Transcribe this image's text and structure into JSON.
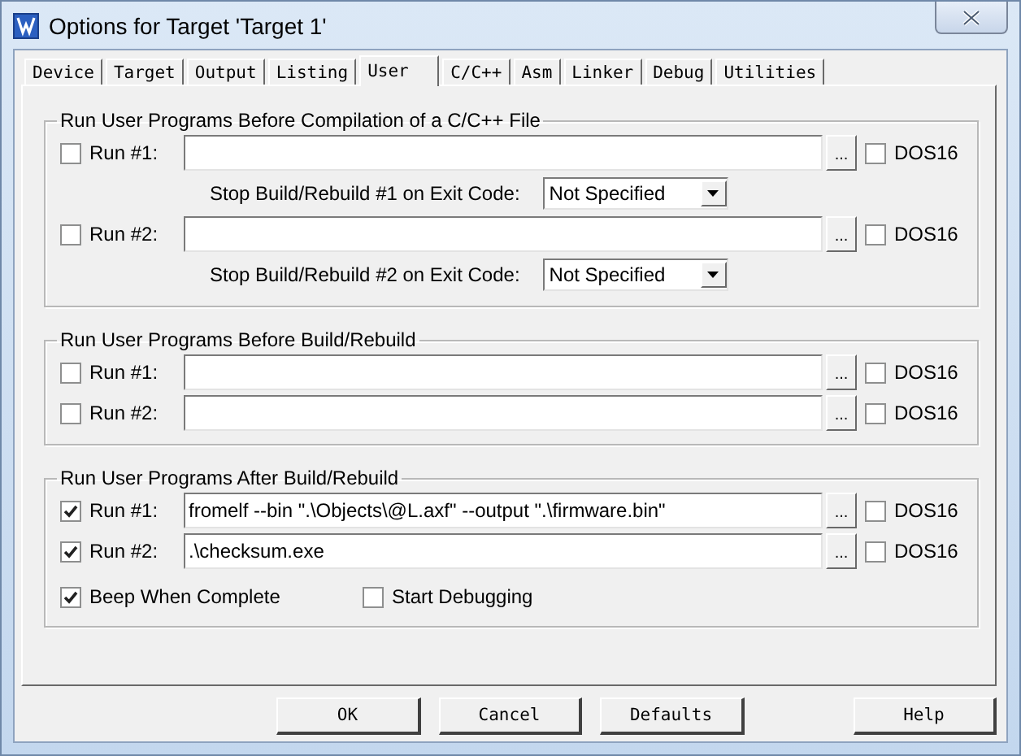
{
  "window": {
    "title": "Options for Target 'Target 1'"
  },
  "tabs": [
    {
      "label": "Device",
      "selected": false
    },
    {
      "label": "Target",
      "selected": false
    },
    {
      "label": "Output",
      "selected": false
    },
    {
      "label": "Listing",
      "selected": false
    },
    {
      "label": "User",
      "selected": true
    },
    {
      "label": "C/C++",
      "selected": false
    },
    {
      "label": "Asm",
      "selected": false
    },
    {
      "label": "Linker",
      "selected": false
    },
    {
      "label": "Debug",
      "selected": false
    },
    {
      "label": "Utilities",
      "selected": false
    }
  ],
  "groups": [
    {
      "title": "Run User Programs Before Compilation of a C/C++ File",
      "rows": [
        {
          "kind": "run",
          "label": "Run #1:",
          "checked": false,
          "browse": "...",
          "dos16": {
            "label": "DOS16",
            "checked": false
          }
        },
        {
          "kind": "exit-code",
          "label": "Stop Build/Rebuild #1 on Exit Code:",
          "selection": "Not Specified"
        },
        {
          "kind": "run",
          "label": "Run #2:",
          "checked": false,
          "browse": "...",
          "dos16": {
            "label": "DOS16",
            "checked": false
          }
        },
        {
          "kind": "exit-code",
          "label": "Stop Build/Rebuild #2 on Exit Code:",
          "selection": "Not Specified"
        }
      ]
    },
    {
      "title": "Run User Programs Before Build/Rebuild",
      "rows": [
        {
          "kind": "run",
          "label": "Run #1:",
          "checked": false,
          "browse": "...",
          "dos16": {
            "label": "DOS16",
            "checked": false
          }
        },
        {
          "kind": "run",
          "label": "Run #2:",
          "checked": false,
          "browse": "...",
          "dos16": {
            "label": "DOS16",
            "checked": false
          }
        }
      ]
    },
    {
      "title": "Run User Programs After Build/Rebuild",
      "rows": [
        {
          "kind": "run",
          "label": "Run #1:",
          "checked": true,
          "value": "fromelf --bin \".\\Objects\\@L.axf\" --output \".\\firmware.bin\"",
          "browse": "...",
          "dos16": {
            "label": "DOS16",
            "checked": false
          }
        },
        {
          "kind": "run",
          "label": "Run #2:",
          "checked": true,
          "value": ".\\checksum.exe",
          "browse": "...",
          "dos16": {
            "label": "DOS16",
            "checked": false
          }
        },
        {
          "kind": "options",
          "items": [
            {
              "label": "Beep When Complete",
              "checked": true
            },
            {
              "label": "Start Debugging",
              "checked": false
            }
          ]
        }
      ]
    }
  ],
  "buttons": [
    "OK",
    "Cancel",
    "Defaults"
  ],
  "help_button": "Help"
}
